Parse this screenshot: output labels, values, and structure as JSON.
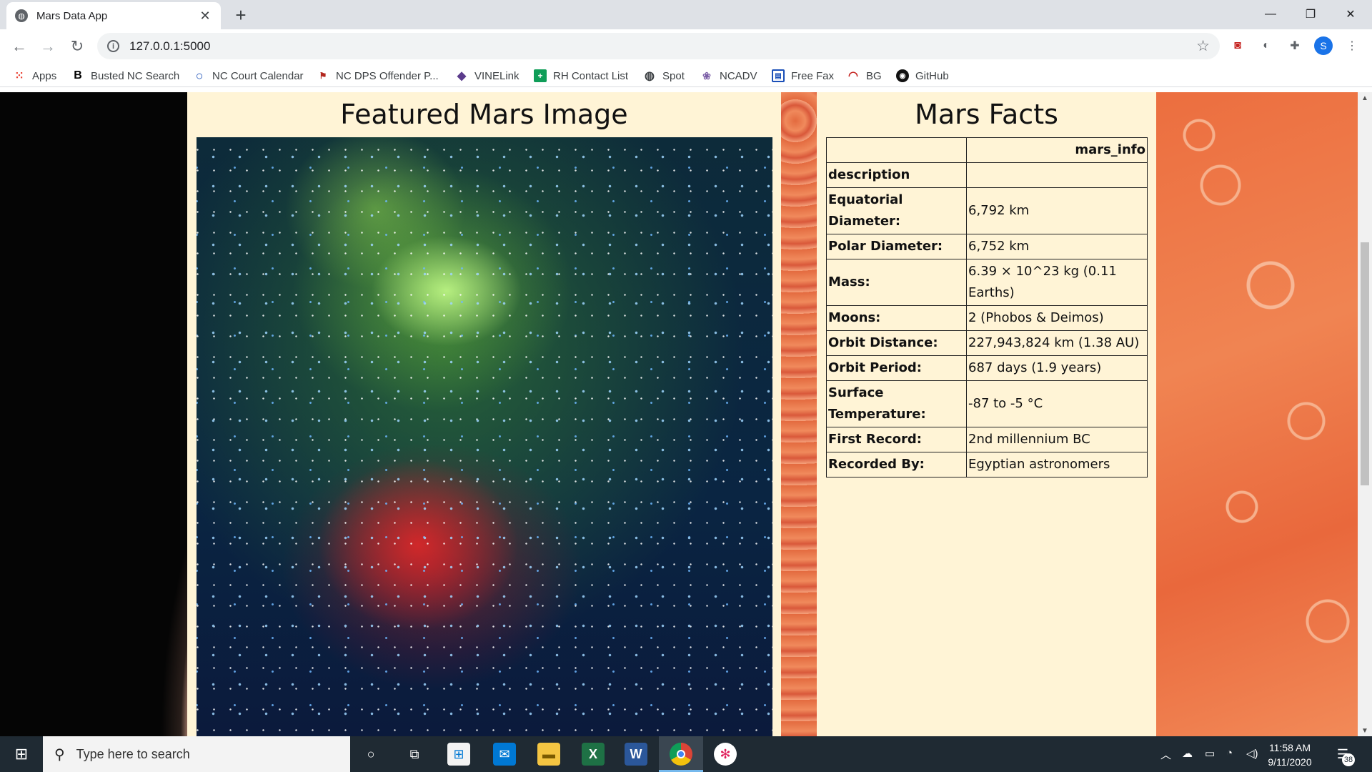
{
  "browser": {
    "tab_title": "Mars Data App",
    "tab_close": "✕",
    "new_tab": "+",
    "url": "127.0.0.1:5000",
    "window": {
      "minimize": "—",
      "restore": "❐",
      "close": "✕"
    },
    "profile_initial": "S"
  },
  "bookmarks": [
    {
      "label": "Apps",
      "icon": "apps-grid-icon"
    },
    {
      "label": "Busted NC Search",
      "icon": "b-logo-icon"
    },
    {
      "label": "NC Court Calendar",
      "icon": "circle-outline-icon"
    },
    {
      "label": "NC DPS Offender P...",
      "icon": "flag-icon"
    },
    {
      "label": "VINELink",
      "icon": "vine-icon"
    },
    {
      "label": "RH Contact List",
      "icon": "plus-green-icon"
    },
    {
      "label": "Spot",
      "icon": "globe-icon"
    },
    {
      "label": "NCADV",
      "icon": "dots-logo-icon"
    },
    {
      "label": "Free Fax",
      "icon": "fax-icon"
    },
    {
      "label": "BG",
      "icon": "arc-icon"
    },
    {
      "label": "GitHub",
      "icon": "github-icon"
    }
  ],
  "featured": {
    "heading": "Featured Mars Image"
  },
  "facts": {
    "heading": "Mars Facts",
    "column_header": "mars_info",
    "index_label": "description",
    "rows": [
      {
        "key": "Equatorial Diameter:",
        "value": "6,792 km"
      },
      {
        "key": "Polar Diameter:",
        "value": "6,752 km"
      },
      {
        "key": "Mass:",
        "value": "6.39 × 10^23 kg (0.11 Earths)"
      },
      {
        "key": "Moons:",
        "value": "2 (Phobos & Deimos)"
      },
      {
        "key": "Orbit Distance:",
        "value": "227,943,824 km (1.38 AU)"
      },
      {
        "key": "Orbit Period:",
        "value": "687 days (1.9 years)"
      },
      {
        "key": "Surface Temperature:",
        "value": "-87 to -5 °C"
      },
      {
        "key": "First Record:",
        "value": "2nd millennium BC"
      },
      {
        "key": "Recorded By:",
        "value": "Egyptian astronomers"
      }
    ]
  },
  "taskbar": {
    "search_placeholder": "Type here to search",
    "time": "11:58 AM",
    "date": "9/11/2020",
    "notification_count": "38"
  }
}
